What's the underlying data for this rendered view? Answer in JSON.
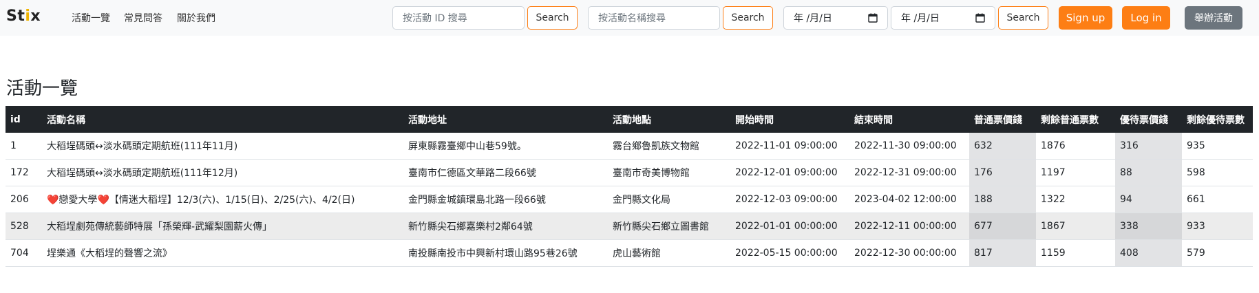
{
  "brand": {
    "prefix": "St",
    "accent": "i",
    "suffix": "x"
  },
  "nav": {
    "links": [
      "活動一覽",
      "常見問答",
      "關於我們"
    ]
  },
  "search": {
    "id_placeholder": "按活動 ID 搜尋",
    "id_button": "Search",
    "name_placeholder": "按活動名稱搜尋",
    "name_button": "Search",
    "date_start": "年 /月/日",
    "date_end": "年 /月/日",
    "date_button": "Search"
  },
  "auth": {
    "signup": "Sign up",
    "login": "Log in",
    "host": "舉辦活動"
  },
  "page": {
    "title": "活動一覽"
  },
  "table": {
    "headers": [
      "id",
      "活動名稱",
      "活動地址",
      "活動地點",
      "開始時間",
      "結束時間",
      "普通票價錢",
      "剩餘普通票數",
      "優待票價錢",
      "剩餘優待票數"
    ],
    "rows": [
      {
        "id": "1",
        "name": "大稻埕碼頭↔淡水碼頭定期航班(111年11月)",
        "address": "屏東縣霧臺鄉中山巷59號。",
        "venue": "霧台鄉魯凱族文物館",
        "start": "2022-11-01 09:00:00",
        "end": "2022-11-30 09:00:00",
        "price": "632",
        "remain": "1876",
        "disc_price": "316",
        "disc_remain": "935"
      },
      {
        "id": "172",
        "name": "大稻埕碼頭↔淡水碼頭定期航班(111年12月)",
        "address": "臺南市仁德區文華路二段66號",
        "venue": "臺南市奇美博物館",
        "start": "2022-12-01 09:00:00",
        "end": "2022-12-31 09:00:00",
        "price": "176",
        "remain": "1197",
        "disc_price": "88",
        "disc_remain": "598"
      },
      {
        "id": "206",
        "name_heart1": "❤️",
        "name": "戀愛大學",
        "name_heart2": "❤️",
        "name_rest": "【情迷大稻埕】12/3(六)、1/15(日)、2/25(六)、4/2(日)",
        "address": "金門縣金城鎮環島北路一段66號",
        "venue": "金門縣文化局",
        "start": "2022-12-03 09:00:00",
        "end": "2023-04-02 12:00:00",
        "price": "188",
        "remain": "1322",
        "disc_price": "94",
        "disc_remain": "661"
      },
      {
        "id": "528",
        "name": "大稻埕劇苑傳統藝師特展「孫榮輝-武耀梨園薪火傳」",
        "address": "新竹縣尖石鄉嘉樂村2鄰64號",
        "venue": "新竹縣尖石鄉立圖書館",
        "start": "2022-01-01 00:00:00",
        "end": "2022-12-11 00:00:00",
        "price": "677",
        "remain": "1867",
        "disc_price": "338",
        "disc_remain": "933"
      },
      {
        "id": "704",
        "name": "埕樂通《大稻埕的聲響之流》",
        "address": "南投縣南投市中興新村環山路95巷26號",
        "venue": "虎山藝術館",
        "start": "2022-05-15 00:00:00",
        "end": "2022-12-30 00:00:00",
        "price": "817",
        "remain": "1159",
        "disc_price": "408",
        "disc_remain": "579"
      }
    ]
  }
}
